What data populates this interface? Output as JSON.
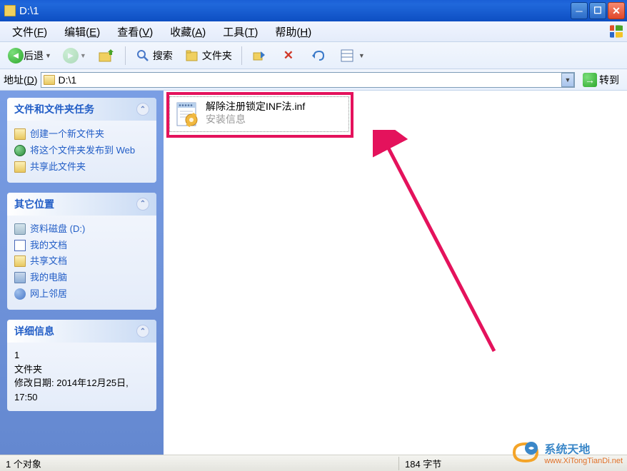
{
  "titlebar": {
    "title": "D:\\1"
  },
  "menubar": {
    "file": "文件(F)",
    "edit": "编辑(E)",
    "view": "查看(V)",
    "favorites": "收藏(A)",
    "tools": "工具(T)",
    "help": "帮助(H)"
  },
  "toolbar": {
    "back": "后退",
    "search": "搜索",
    "folders": "文件夹"
  },
  "addressbar": {
    "label": "地址(D)",
    "path": "D:\\1",
    "go": "转到"
  },
  "sidebar": {
    "tasks": {
      "title": "文件和文件夹任务",
      "items": [
        "创建一个新文件夹",
        "将这个文件夹发布到 Web",
        "共享此文件夹"
      ]
    },
    "other": {
      "title": "其它位置",
      "items": [
        "资料磁盘 (D:)",
        "我的文档",
        "共享文档",
        "我的电脑",
        "网上邻居"
      ]
    },
    "details": {
      "title": "详细信息",
      "name": "1",
      "type": "文件夹",
      "modified": "修改日期: 2014年12月25日, 17:50"
    }
  },
  "file": {
    "name": "解除注册锁定INF法.inf",
    "type": "安装信息"
  },
  "statusbar": {
    "left": "1 个对象",
    "mid": "184 字节"
  },
  "watermark": {
    "text": "系统天地",
    "url": "www.XiTongTianDi.net"
  }
}
